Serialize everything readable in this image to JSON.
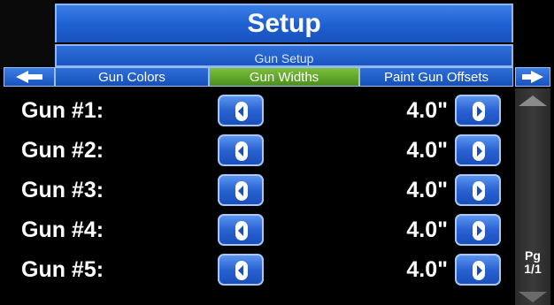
{
  "header": {
    "title": "Setup",
    "subtitle": "Gun Setup"
  },
  "tabs": [
    {
      "label": "Gun Colors",
      "active": false
    },
    {
      "label": "Gun Widths",
      "active": true
    },
    {
      "label": "Paint Gun Offsets",
      "active": false
    }
  ],
  "rows": [
    {
      "label": "Gun #1:",
      "value": "4.0\""
    },
    {
      "label": "Gun #2:",
      "value": "4.0\""
    },
    {
      "label": "Gun #3:",
      "value": "4.0\""
    },
    {
      "label": "Gun #4:",
      "value": "4.0\""
    },
    {
      "label": "Gun #5:",
      "value": "4.0\""
    }
  ],
  "pager": {
    "label": "Pg",
    "value": "1/1"
  },
  "colors": {
    "accent_blue": "#1e5fd0",
    "active_tab_green": "#5fa52a",
    "background": "#000000"
  },
  "icons": {
    "tab_prev": "triangle-left-icon",
    "tab_next": "triangle-right-icon",
    "decrease": "arrow-left-icon",
    "increase": "arrow-right-icon",
    "scroll_up": "scroll-up-icon",
    "scroll_down": "scroll-down-icon"
  }
}
